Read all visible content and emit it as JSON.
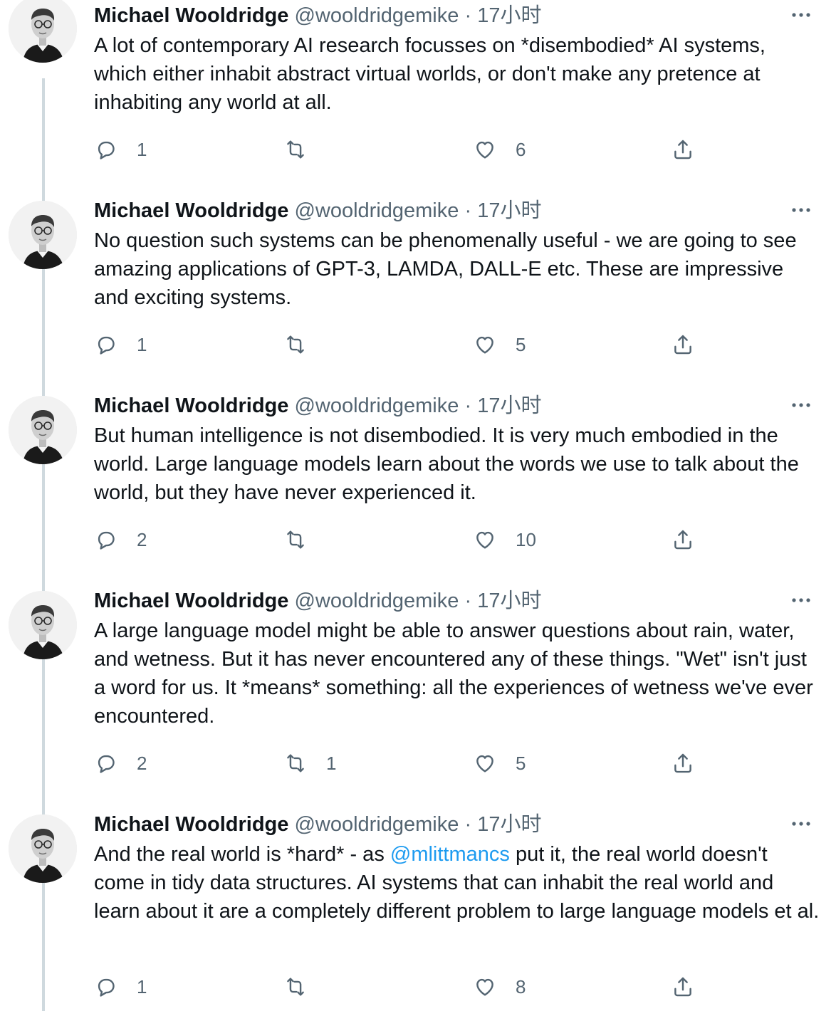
{
  "icons": {
    "avatar": "avatar",
    "more": "more-horizontal-icon",
    "reply": "reply-bubble-icon",
    "retweet": "retweet-icon",
    "like": "heart-icon",
    "share": "share-upload-icon"
  },
  "colors": {
    "mention": "#1d9bf0",
    "secondary_text": "#536471",
    "thread_line": "#cfd9de"
  },
  "tweets": [
    {
      "author": {
        "name": "Michael Wooldridge",
        "handle": "@wooldridgemike",
        "separator": "·",
        "time": "17小时"
      },
      "text": "A lot of contemporary AI research focusses on *disembodied* AI systems, which either inhabit abstract virtual worlds, or don't make any pretence at inhabiting any world at all.",
      "stats": {
        "replies": "1",
        "retweets": "",
        "likes": "6"
      }
    },
    {
      "author": {
        "name": "Michael Wooldridge",
        "handle": "@wooldridgemike",
        "separator": "·",
        "time": "17小时"
      },
      "text": "No question such systems can be phenomenally useful - we are going to see amazing applications of GPT-3, LAMDA, DALL-E etc. These are impressive and exciting systems.",
      "stats": {
        "replies": "1",
        "retweets": "",
        "likes": "5"
      }
    },
    {
      "author": {
        "name": "Michael Wooldridge",
        "handle": "@wooldridgemike",
        "separator": "·",
        "time": "17小时"
      },
      "text": "But human intelligence is not disembodied. It is very much embodied in the world. Large language models learn about the words we use to talk about the world, but they have never experienced it.",
      "stats": {
        "replies": "2",
        "retweets": "",
        "likes": "10"
      }
    },
    {
      "author": {
        "name": "Michael Wooldridge",
        "handle": "@wooldridgemike",
        "separator": "·",
        "time": "17小时"
      },
      "text": "A large language model might be able to answer questions about rain, water, and wetness. But it has never encountered any of these things. \"Wet\" isn't just a word for us. It *means* something: all the experiences of wetness we've ever encountered.",
      "stats": {
        "replies": "2",
        "retweets": "1",
        "likes": "5"
      }
    },
    {
      "author": {
        "name": "Michael Wooldridge",
        "handle": "@wooldridgemike",
        "separator": "·",
        "time": "17小时"
      },
      "text_before": "And the real world is *hard* - as ",
      "mention": "@mlittmancs",
      "text_after": " put it, the real world doesn't come in tidy data structures. AI systems that can inhabit the real world and learn about it are a completely different problem to large language models et al.",
      "stats": {
        "replies": "1",
        "retweets": "",
        "likes": "8"
      }
    }
  ]
}
